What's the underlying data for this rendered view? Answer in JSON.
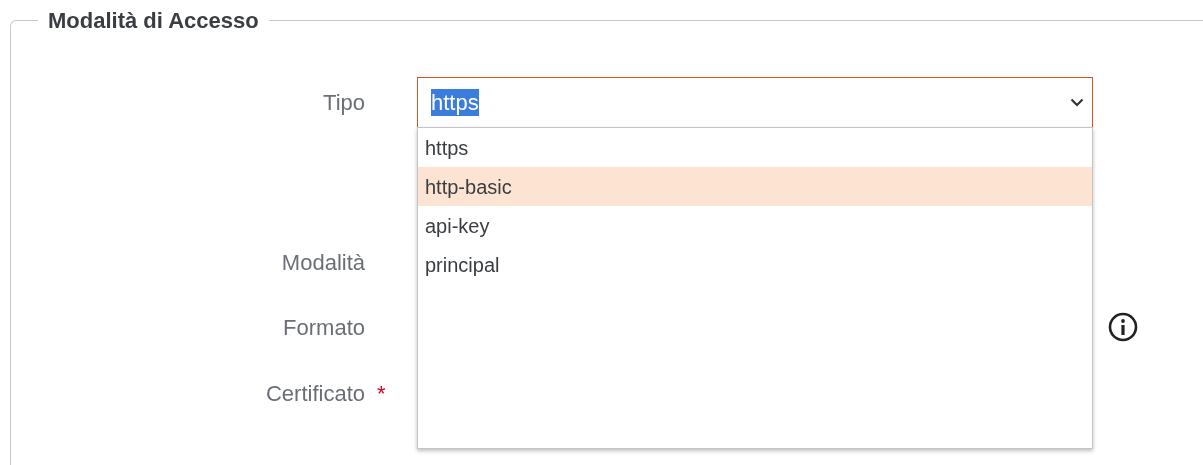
{
  "section": {
    "title": "Modalità di Accesso"
  },
  "required_symbol": "*",
  "fields": [
    {
      "label": "Tipo",
      "required": false,
      "info": false,
      "kind": "select",
      "value": "https",
      "value_highlighted": true,
      "expanded": true
    },
    {
      "label": "Modalità",
      "required": false,
      "info": false,
      "kind": "hidden"
    },
    {
      "label": "Formato",
      "required": false,
      "info": true,
      "kind": "hidden"
    },
    {
      "label": "Certificato",
      "required": true,
      "info": false,
      "kind": "hidden"
    }
  ],
  "options": [
    {
      "label": "https",
      "selected": false
    },
    {
      "label": "http-basic",
      "selected": true
    },
    {
      "label": "api-key",
      "selected": false
    },
    {
      "label": "principal",
      "selected": false
    }
  ]
}
